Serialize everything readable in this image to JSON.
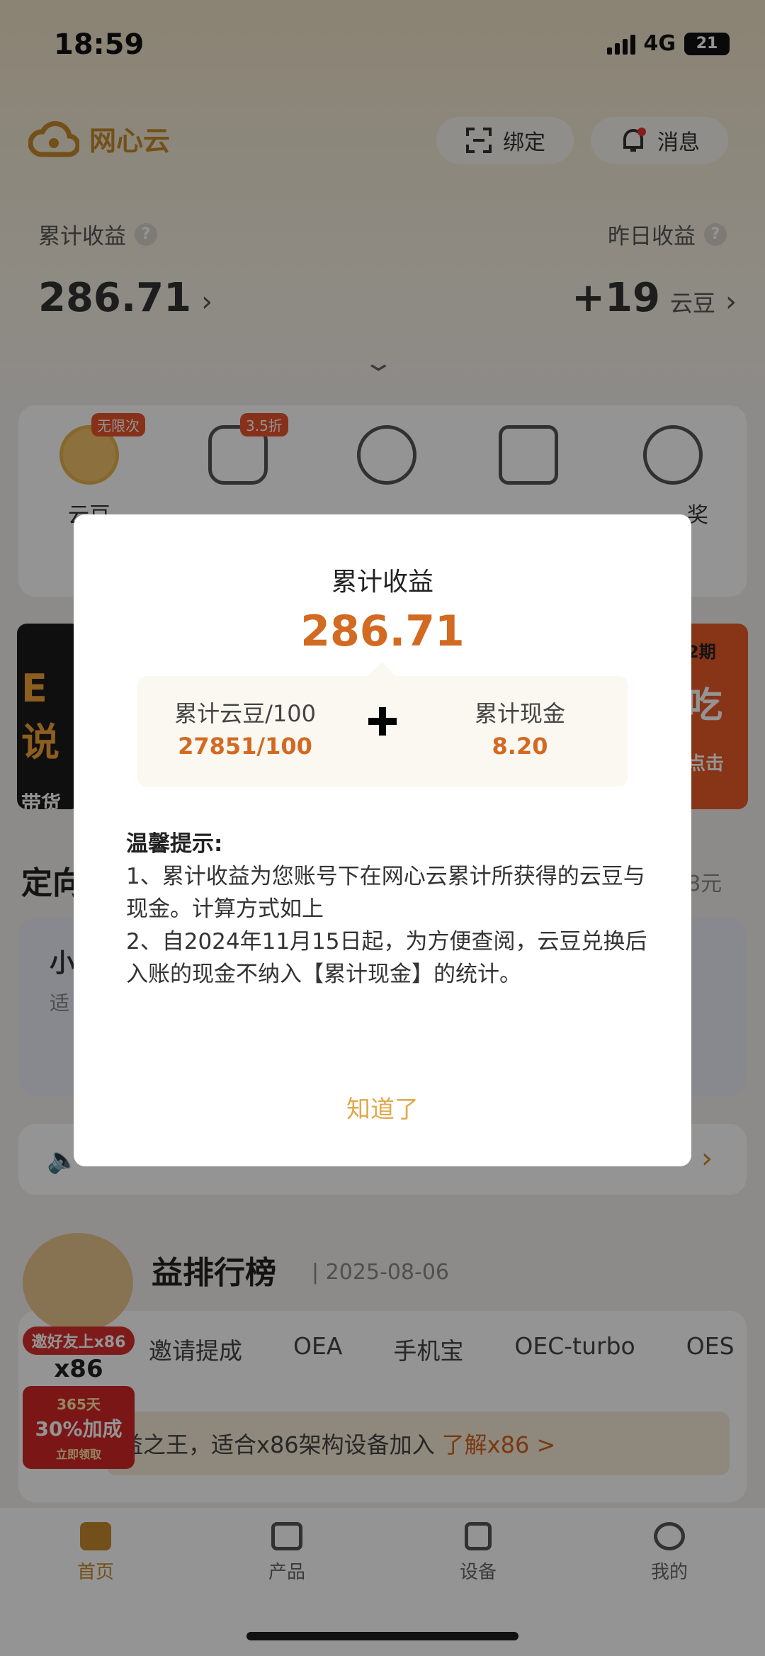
{
  "status_bar": {
    "time": "18:59",
    "network": "4G",
    "battery": "21"
  },
  "header": {
    "app_name": "网心云",
    "bind_label": "绑定",
    "message_label": "消息",
    "total_label": "累计收益",
    "total_value": "286.71",
    "yesterday_label": "昨日收益",
    "yesterday_value": "+19",
    "yesterday_unit": "云豆"
  },
  "features": [
    {
      "label": "云豆",
      "badge": "无限次"
    },
    {
      "label": "",
      "badge": "3.5折"
    },
    {
      "label": "",
      "badge": ""
    },
    {
      "label": "",
      "badge": ""
    },
    {
      "label": "奖",
      "badge": ""
    }
  ],
  "banners": {
    "left_text": "E说",
    "left_sub": "带货",
    "right_top": "2期",
    "right_text": "吃",
    "right_sub": "点击"
  },
  "sections": {
    "targeted_title": "定向",
    "targeted_right": "8元",
    "small_item": "小",
    "small_sub": "适",
    "notice_icon_label": "消息",
    "ranking_title": "益排行榜",
    "ranking_date": "2025-08-06",
    "tabs": [
      "x86",
      "邀请提成",
      "OEA",
      "手机宝",
      "OEC-turbo",
      "OES"
    ],
    "tip_text": "益之王，适合x86架构设备加入",
    "tip_link": "了解x86 >"
  },
  "promo": {
    "tag": "邀好友上x86",
    "title": "x86",
    "days": "365天",
    "boost": "30%加成",
    "cta": "立即领取"
  },
  "bottom_nav": [
    {
      "label": "首页",
      "active": true
    },
    {
      "label": "产品",
      "active": false
    },
    {
      "label": "设备",
      "active": false
    },
    {
      "label": "我的",
      "active": false
    }
  ],
  "modal": {
    "title": "累计收益",
    "total": "286.71",
    "beans_label": "累计云豆/100",
    "beans_value": "27851/100",
    "cash_label": "累计现金",
    "cash_value": "8.20",
    "notes_title": "温馨提示:",
    "note1": "1、累计收益为您账号下在网心云累计所获得的云豆与现金。计算方式如上",
    "note2": "2、自2024年11月15日起，为方便查阅，云豆兑换后入账的现金不纳入【累计现金】的统计。",
    "confirm": "知道了"
  },
  "colors": {
    "accent": "#d26a22",
    "brand": "#c78a2c",
    "confirm": "#e0a94d"
  }
}
